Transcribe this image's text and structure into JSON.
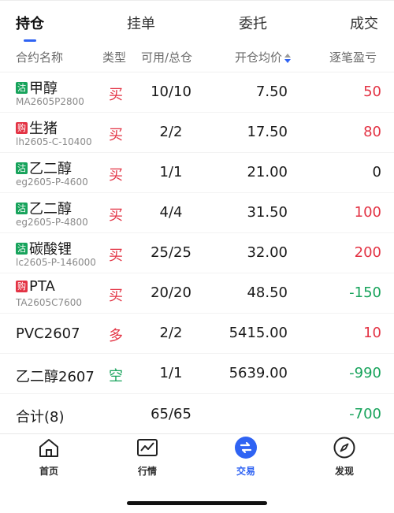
{
  "tabs": [
    {
      "label": "持仓",
      "active": true
    },
    {
      "label": "挂单",
      "active": false
    },
    {
      "label": "委托",
      "active": false
    },
    {
      "label": "成交",
      "active": false
    }
  ],
  "columns": {
    "name": "合约名称",
    "type": "类型",
    "qty": "可用/总仓",
    "price": "开仓均价",
    "pnl": "逐笔盈亏"
  },
  "positions": [
    {
      "badge": "沽",
      "badge_color": "#17a35b",
      "name": "甲醇",
      "code": "MA2605P2800",
      "type": "买",
      "type_color": "#e33344",
      "qty": "10/10",
      "price": "7.50",
      "pnl": "50",
      "pnl_color": "#e33344"
    },
    {
      "badge": "购",
      "badge_color": "#e33344",
      "name": "生猪",
      "code": "lh2605-C-10400",
      "type": "买",
      "type_color": "#e33344",
      "qty": "2/2",
      "price": "17.50",
      "pnl": "80",
      "pnl_color": "#e33344"
    },
    {
      "badge": "沽",
      "badge_color": "#17a35b",
      "name": "乙二醇",
      "code": "eg2605-P-4600",
      "type": "买",
      "type_color": "#e33344",
      "qty": "1/1",
      "price": "21.00",
      "pnl": "0",
      "pnl_color": "#1a1a1a"
    },
    {
      "badge": "沽",
      "badge_color": "#17a35b",
      "name": "乙二醇",
      "code": "eg2605-P-4800",
      "type": "买",
      "type_color": "#e33344",
      "qty": "4/4",
      "price": "31.50",
      "pnl": "100",
      "pnl_color": "#e33344"
    },
    {
      "badge": "沽",
      "badge_color": "#17a35b",
      "name": "碳酸锂",
      "code": "lc2605-P-146000",
      "type": "买",
      "type_color": "#e33344",
      "qty": "25/25",
      "price": "32.00",
      "pnl": "200",
      "pnl_color": "#e33344"
    },
    {
      "badge": "购",
      "badge_color": "#e33344",
      "name": "PTA",
      "code": "TA2605C7600",
      "type": "买",
      "type_color": "#e33344",
      "qty": "20/20",
      "price": "48.50",
      "pnl": "-150",
      "pnl_color": "#17a35b"
    },
    {
      "badge": "",
      "badge_color": "",
      "name": "PVC2607",
      "code": "",
      "type": "多",
      "type_color": "#e33344",
      "qty": "2/2",
      "price": "5415.00",
      "pnl": "10",
      "pnl_color": "#e33344"
    },
    {
      "badge": "",
      "badge_color": "",
      "name": "乙二醇2607",
      "code": "",
      "type": "空",
      "type_color": "#17a35b",
      "qty": "1/1",
      "price": "5639.00",
      "pnl": "-990",
      "pnl_color": "#17a35b"
    }
  ],
  "total": {
    "label": "合计(8)",
    "qty": "65/65",
    "pnl": "-700"
  },
  "nav": [
    {
      "label": "首页",
      "icon": "home-icon",
      "active": false
    },
    {
      "label": "行情",
      "icon": "market-chart-icon",
      "active": false
    },
    {
      "label": "交易",
      "icon": "trade-icon",
      "active": true
    },
    {
      "label": "发现",
      "icon": "compass-icon",
      "active": false
    }
  ],
  "colors": {
    "accent": "#2f63f3",
    "up": "#e33344",
    "down": "#17a35b"
  }
}
